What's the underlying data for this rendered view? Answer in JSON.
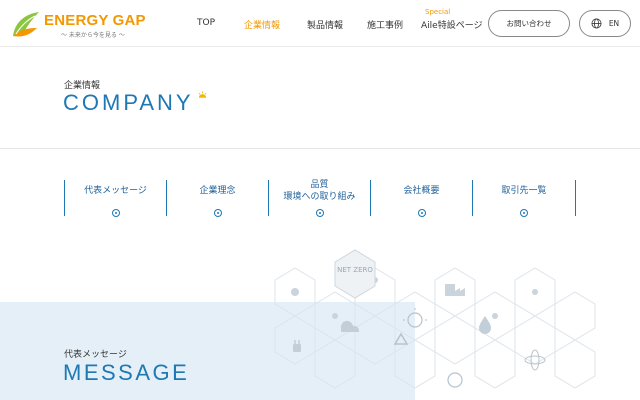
{
  "header": {
    "logo_text": "ENERGY GAP",
    "logo_tagline": "〜 未来から今を見る 〜",
    "nav": [
      {
        "label": "TOP"
      },
      {
        "label": "企業情報",
        "active": true
      },
      {
        "label": "製品情報"
      },
      {
        "label": "施工事例"
      },
      {
        "label": "Aile特設ページ",
        "badge": "Special"
      }
    ],
    "contact_label": "お問い合わせ",
    "lang_label": "EN",
    "accent_color": "#f39800"
  },
  "company": {
    "title_jp": "企業情報",
    "title_en": "COMPANY"
  },
  "subnav": [
    {
      "label": "代表メッセージ"
    },
    {
      "label": "企業理念"
    },
    {
      "label": "品質",
      "label2": "環境への取り組み"
    },
    {
      "label": "会社概要"
    },
    {
      "label": "取引先一覧"
    }
  ],
  "message": {
    "title_jp": "代表メッセージ",
    "title_en": "MESSAGE"
  },
  "hex_art": {
    "net_zero_text": "NET ZERO"
  },
  "brand_color": "#1e78b4"
}
